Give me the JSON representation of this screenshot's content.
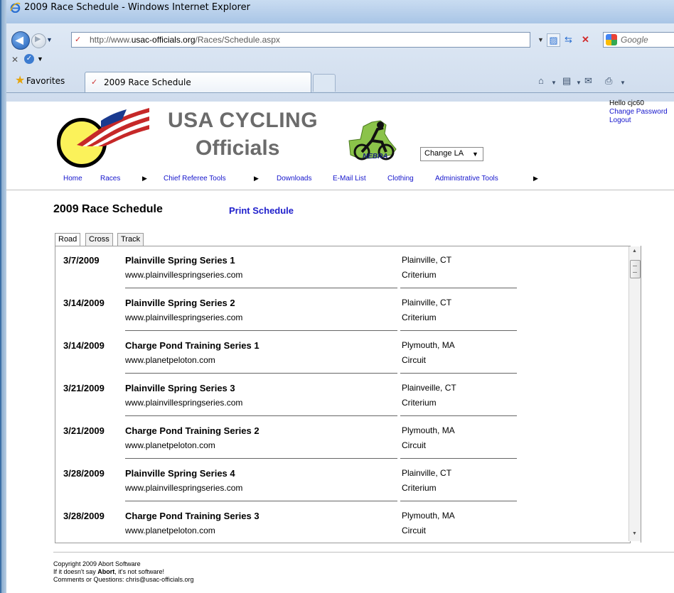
{
  "browser": {
    "window_title": "2009 Race Schedule - Windows Internet Explorer",
    "url_prefix": "http://www.",
    "url_domain": "usac-officials.org",
    "url_path": "/Races/Schedule.aspx",
    "search_placeholder": "Google",
    "favorites_label": "Favorites",
    "tab_title": "2009 Race Schedule"
  },
  "site": {
    "title_line1": "USA CYCLING",
    "title_line2": "Officials",
    "nebra_label": "NEBRA",
    "la_select_value": "Change LA"
  },
  "user": {
    "hello": "Hello cjc60",
    "change_password": "Change Password",
    "logout": "Logout"
  },
  "menu": {
    "home": "Home",
    "races": "Races",
    "chief_referee_tools": "Chief Referee Tools",
    "downloads": "Downloads",
    "email_list": "E-Mail List",
    "clothing": "Clothing",
    "admin_tools": "Administrative Tools"
  },
  "page": {
    "title": "2009 Race Schedule",
    "print_link": "Print Schedule",
    "tabs": [
      "Road",
      "Cross",
      "Track"
    ]
  },
  "races": [
    {
      "date": "3/7/2009",
      "name": "Plainville Spring Series 1",
      "url": "www.plainvillespringseries.com",
      "location": "Plainville, CT",
      "type": "Criterium"
    },
    {
      "date": "3/14/2009",
      "name": "Plainville Spring Series 2",
      "url": "www.plainvillespringseries.com",
      "location": "Plainville, CT",
      "type": "Criterium"
    },
    {
      "date": "3/14/2009",
      "name": "Charge Pond Training Series 1",
      "url": "www.planetpeloton.com",
      "location": "Plymouth, MA",
      "type": "Circuit"
    },
    {
      "date": "3/21/2009",
      "name": "Plainville Spring Series 3",
      "url": "www.plainvillespringseries.com",
      "location": "Plainveille, CT",
      "type": "Criterium"
    },
    {
      "date": "3/21/2009",
      "name": "Charge Pond Training Series 2",
      "url": "www.planetpeloton.com",
      "location": "Plymouth, MA",
      "type": "Circuit"
    },
    {
      "date": "3/28/2009",
      "name": "Plainville Spring Series 4",
      "url": "www.plainvillespringseries.com",
      "location": "Plainville, CT",
      "type": "Criterium"
    },
    {
      "date": "3/28/2009",
      "name": "Charge Pond Training Series 3",
      "url": "www.planetpeloton.com",
      "location": "Plymouth, MA",
      "type": "Circuit"
    }
  ],
  "footer": {
    "line1": "Copyright 2009 Abort Software",
    "line2_pre": "If it doesn't say ",
    "line2_bold": "Abort",
    "line2_post": ", it's not software!",
    "line3": "Comments or Questions: chris@usac-officials.org"
  }
}
